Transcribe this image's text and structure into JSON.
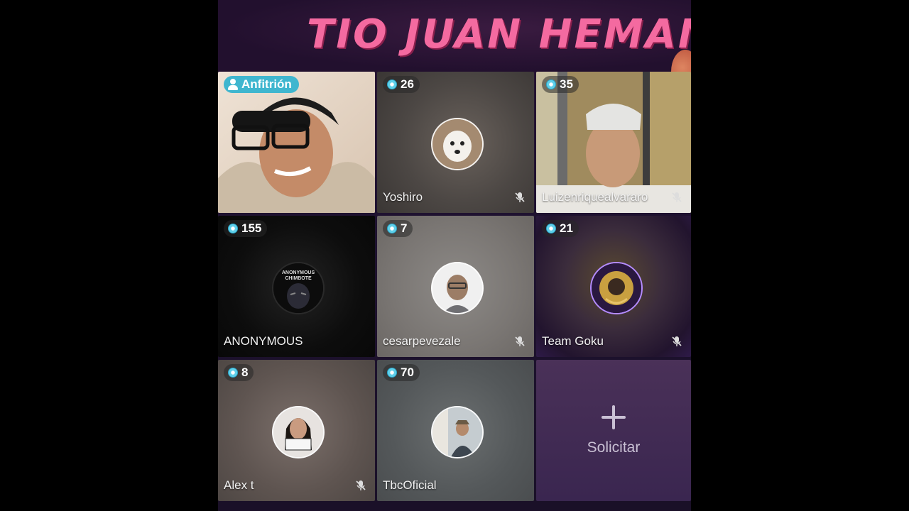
{
  "banner": {
    "title": "TIO JUAN HEMANO"
  },
  "tiles": [
    {
      "name": "",
      "badge": "Anfitrión",
      "host": true
    },
    {
      "name": "Yoshiro",
      "badge": "26",
      "muted": true
    },
    {
      "name": "Luizenriquealvararo",
      "badge": "35",
      "muted": true
    },
    {
      "name": "ANONYMOUS",
      "badge": "155",
      "muted": false,
      "avatar_text": "ANONYMOUS CHIMBOTE"
    },
    {
      "name": "cesarpevezale",
      "badge": "7",
      "muted": true
    },
    {
      "name": "Team Goku",
      "badge": "21",
      "muted": true
    },
    {
      "name": "Alex t",
      "badge": "8",
      "muted": true
    },
    {
      "name": "TbcOficial",
      "badge": "70",
      "muted": false
    }
  ],
  "request": {
    "label": "Solicitar"
  },
  "colors": {
    "title_pink": "#f46aa0",
    "gem_cyan": "#5fd0ea",
    "host_badge": "#3fb6cf"
  }
}
